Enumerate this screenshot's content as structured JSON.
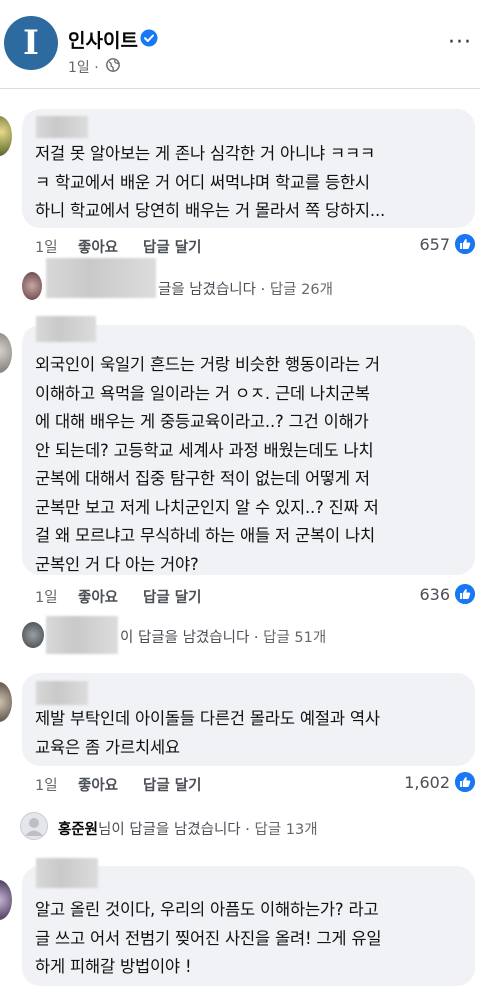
{
  "page": {
    "name": "인사이트",
    "avatar_letter": "I",
    "time": "1일 ·",
    "more": "···"
  },
  "comments": [
    {
      "text": "저걸 못 알아보는 게 존나 심각한 거 아니냐 ㅋㅋㅋ\nㅋ 학교에서 배운 거 어디 써먹냐며 학교를 등한시\n하니 학교에서 당연히 배우는 거 몰라서 쪽 당하지...",
      "time": "1일",
      "like_label": "좋아요",
      "reply_label": "답글 달기",
      "likes": "657",
      "reply_summary": {
        "text": "글을 남겼습니다 · ",
        "count": "답글 26개"
      }
    },
    {
      "text": "외국인이 욱일기 흔드는 거랑 비슷한 행동이라는 거\n이해하고 욕먹을 일이라는 거 ㅇㅈ. 근데 나치군복\n에 대해 배우는 게 중등교육이라고..? 그건 이해가\n안 되는데? 고등학교 세계사 과정 배웠는데도 나치\n군복에 대해서 집중 탐구한 적이 없는데 어떻게 저\n군복만 보고 저게 나치군인지 알 수 있지..? 진짜 저\n걸 왜 모르냐고 무식하네 하는 애들 저 군복이 나치\n군복인 거 다 아는 거야?",
      "time": "1일",
      "like_label": "좋아요",
      "reply_label": "답글 달기",
      "likes": "636",
      "reply_summary": {
        "text": "이 답글을 남겼습니다 · ",
        "count": "답글 51개"
      }
    },
    {
      "text": "제발 부탁인데 아이돌들 다른건 몰라도 예절과 역사\n교육은 좀 가르치세요",
      "time": "1일",
      "like_label": "좋아요",
      "reply_label": "답글 달기",
      "likes": "1,602",
      "reply_summary": {
        "name": "홍준원",
        "text": "님이 답글을 남겼습니다 · ",
        "count": "답글 13개"
      }
    },
    {
      "text": "알고 올린 것이다, 우리의 아픔도 이해하는가? 라고\n글 쓰고 어서 전범기 찢어진 사진을 올려! 그게 유일\n하게 피해갈 방법이야 !"
    }
  ],
  "colors": {
    "accent": "#1877f2",
    "bubble": "#f0f2f5",
    "page_avatar": "#2d6a9f"
  },
  "icons": [
    "verified-badge-icon",
    "globe-icon",
    "more-icon",
    "like-thumb-icon"
  ]
}
